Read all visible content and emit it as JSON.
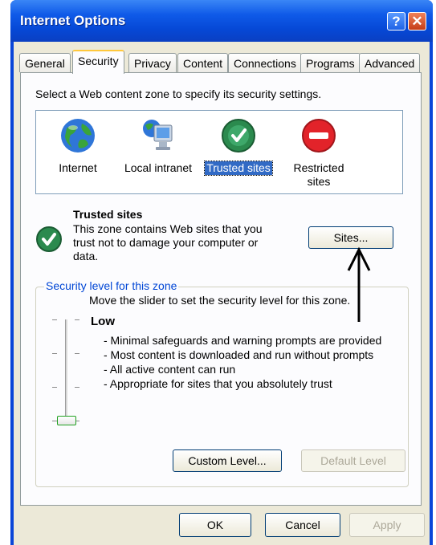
{
  "window": {
    "title": "Internet Options"
  },
  "titlebar_buttons": {
    "help": "?",
    "close": "✕"
  },
  "tabs": [
    {
      "label": "General"
    },
    {
      "label": "Security"
    },
    {
      "label": "Privacy"
    },
    {
      "label": "Content"
    },
    {
      "label": "Connections"
    },
    {
      "label": "Programs"
    },
    {
      "label": "Advanced"
    }
  ],
  "active_tab": "Security",
  "security": {
    "zone_prompt": "Select a Web content zone to specify its security settings.",
    "zones": [
      {
        "label": "Internet",
        "icon": "globe-icon"
      },
      {
        "label": "Local intranet",
        "icon": "intranet-computer-icon"
      },
      {
        "label": "Trusted sites",
        "icon": "trusted-check-icon"
      },
      {
        "label_line1": "Restricted",
        "label_line2": "sites",
        "icon": "restricted-no-entry-icon"
      }
    ],
    "selected_zone": "Trusted sites",
    "zone_info": {
      "title": "Trusted sites",
      "desc_line1": "This zone contains Web sites that you",
      "desc_line2": "trust not to damage your computer or",
      "desc_line3": "data."
    },
    "sites_button": "Sites...",
    "level_group": {
      "legend": "Security level for this zone",
      "instruction": "Move the slider to set the security level for this zone.",
      "level_name": "Low",
      "details": [
        "- Minimal safeguards and warning prompts are provided",
        "- Most content is downloaded and run without prompts",
        "- All active content can run",
        "- Appropriate for sites that you absolutely trust"
      ],
      "slider_level": "Low",
      "custom_level_button": "Custom Level...",
      "default_level_button": "Default Level"
    }
  },
  "footer": {
    "ok": "OK",
    "cancel": "Cancel",
    "apply": "Apply"
  },
  "colors": {
    "title_bar": "#0a46d8",
    "dialog_bg": "#ece9d8",
    "selection": "#316ac5",
    "legend_text": "#0046d5"
  }
}
